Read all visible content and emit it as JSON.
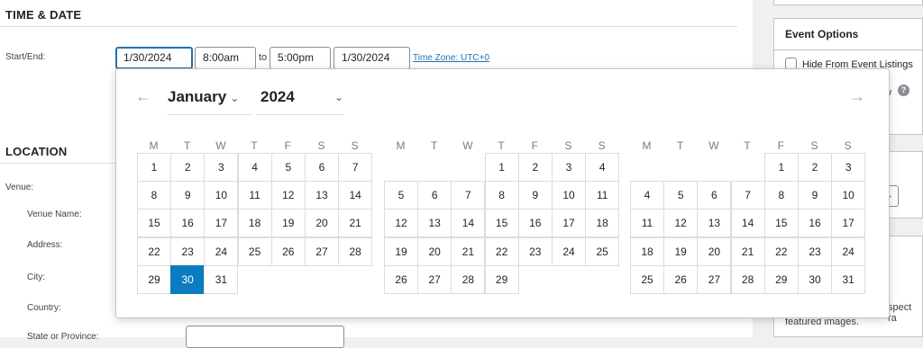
{
  "time_date": {
    "title": "TIME & DATE",
    "start_end_label": "Start/End:",
    "start_date": "1/30/2024",
    "start_time": "8:00am",
    "to": "to",
    "end_time": "5:00pm",
    "end_date": "1/30/2024",
    "timezone": "Time Zone: UTC+0"
  },
  "location": {
    "title": "LOCATION",
    "venue_label": "Venue:",
    "venue_name_label": "Venue Name:",
    "address_label": "Address:",
    "city_label": "City:",
    "country_label": "Country:",
    "state_label": "State or Province:"
  },
  "sidebar": {
    "event_options_title": "Event Options",
    "hide_label": "Hide From Event Listings",
    "partial_w": "w",
    "help_icon": "?",
    "partial_aspect": "spect ra",
    "partial_featured": "featured images."
  },
  "datepicker": {
    "prev": "←",
    "next": "→",
    "month": "January",
    "year": "2024",
    "weekdays": [
      "M",
      "T",
      "W",
      "T",
      "F",
      "S",
      "S"
    ],
    "selected_day": 30,
    "months": [
      {
        "offset": 0,
        "days": 31
      },
      {
        "offset": 3,
        "days": 29
      },
      {
        "offset": 4,
        "days": 31
      }
    ]
  }
}
